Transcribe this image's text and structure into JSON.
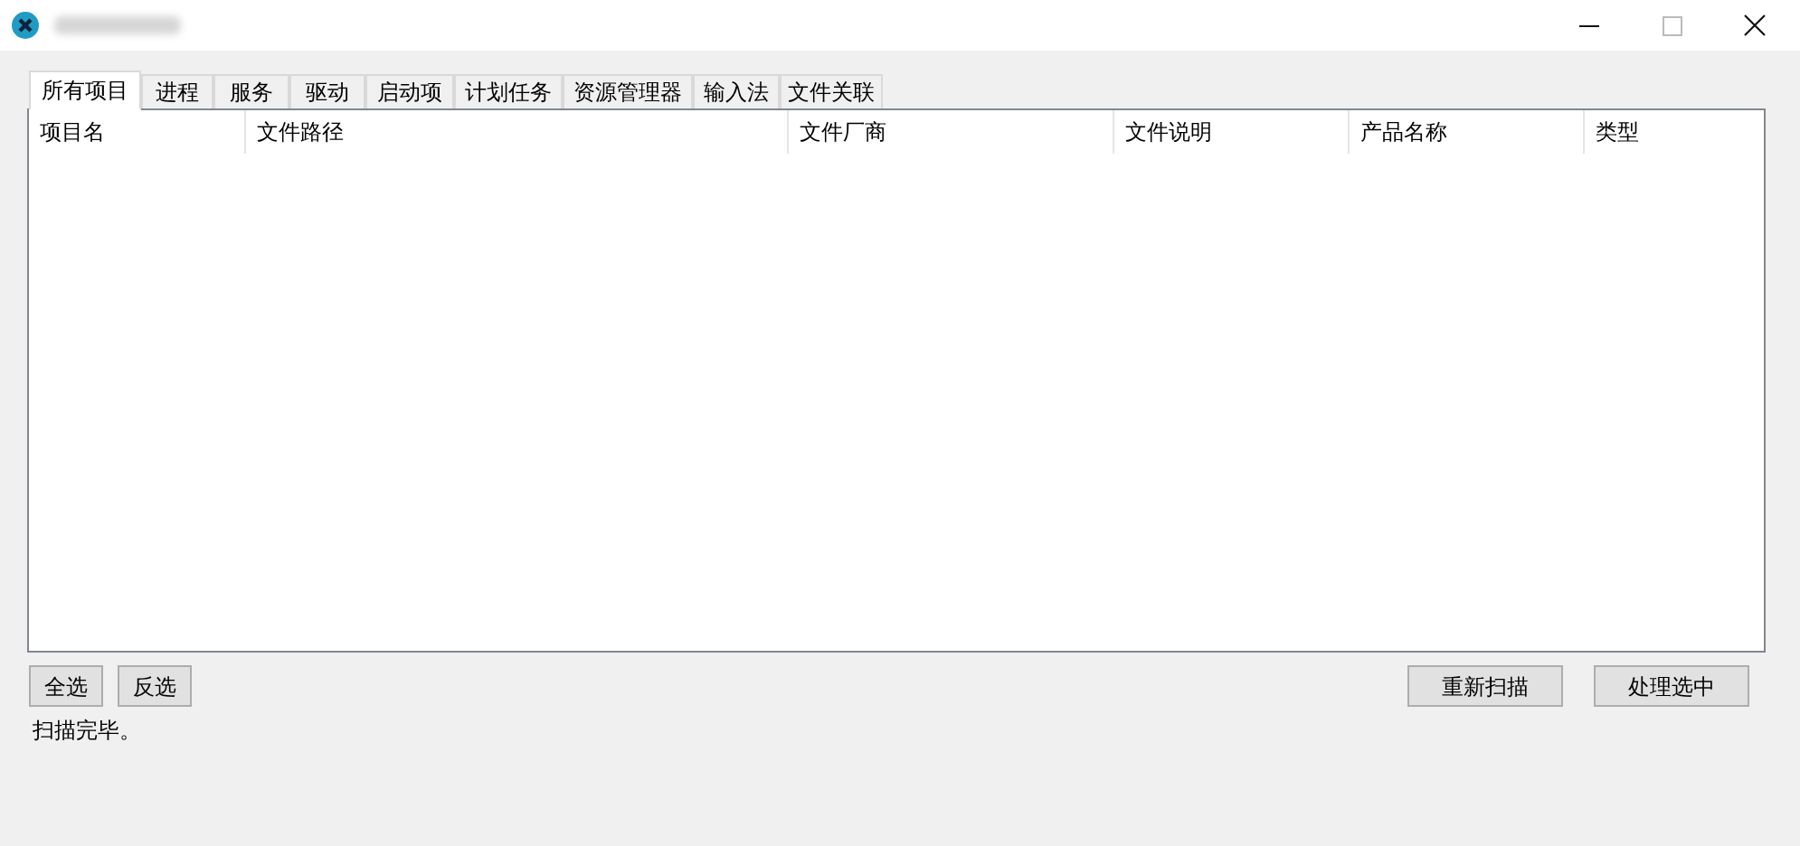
{
  "tabs": [
    {
      "label": "所有项目",
      "selected": true
    },
    {
      "label": "进程",
      "selected": false
    },
    {
      "label": "服务",
      "selected": false
    },
    {
      "label": "驱动",
      "selected": false
    },
    {
      "label": "启动项",
      "selected": false
    },
    {
      "label": "计划任务",
      "selected": false
    },
    {
      "label": "资源管理器",
      "selected": false
    },
    {
      "label": "输入法",
      "selected": false
    },
    {
      "label": "文件关联",
      "selected": false
    }
  ],
  "table": {
    "columns": [
      "项目名",
      "文件路径",
      "文件厂商",
      "文件说明",
      "产品名称",
      "类型"
    ]
  },
  "left_buttons": [
    "全选",
    "反选"
  ],
  "right_buttons": [
    "重新扫描",
    "处理选中"
  ],
  "status_bar": "扫描完毕。"
}
